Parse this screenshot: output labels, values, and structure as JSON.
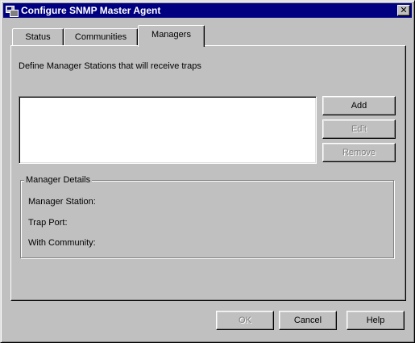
{
  "window": {
    "title": "Configure SNMP Master Agent",
    "icon": "snmp-agent-icon",
    "close_label": "✕"
  },
  "tabs": [
    {
      "label": "Status",
      "active": false
    },
    {
      "label": "Communities",
      "active": false
    },
    {
      "label": "Managers",
      "active": true
    }
  ],
  "managers": {
    "description": "Define Manager Stations that will receive traps",
    "stations": [],
    "buttons": {
      "add": "Add",
      "edit": "Edit",
      "remove": "Remove"
    },
    "details": {
      "legend": "Manager Details",
      "station_label": "Manager Station:",
      "trap_port_label": "Trap Port:",
      "community_label": "With Community:"
    }
  },
  "footer": {
    "ok": "OK",
    "cancel": "Cancel",
    "help": "Help"
  }
}
